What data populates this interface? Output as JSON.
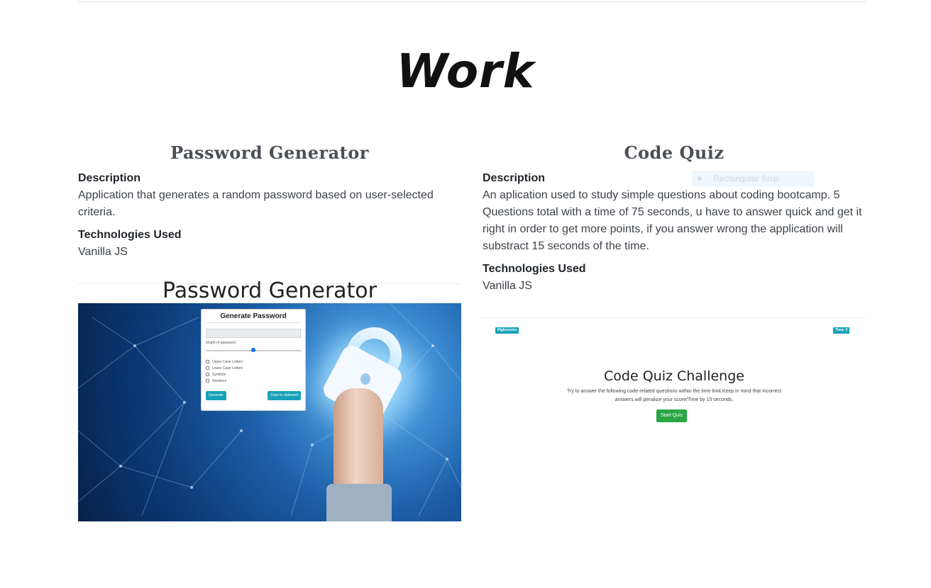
{
  "section": {
    "title": "Work"
  },
  "projects": [
    {
      "title": "Password Generator",
      "description_label": "Description",
      "description": "Application that generates a random password based on user-selected criteria.",
      "tech_label": "Technologies Used",
      "tech": "Vanilla JS",
      "screenshot": {
        "heading": "Password Generator",
        "card_title": "Generate Password",
        "length_label": "length of password",
        "length_value": 0.5,
        "checkboxes": [
          "Upper Case Letters",
          "Lower Case Letters",
          "Symbols",
          "Numbers"
        ],
        "generate_label": "Generate",
        "copy_label": "Copy to clipboard"
      }
    },
    {
      "title": "Code Quiz",
      "description_label": "Description",
      "description": "An aplication used to study simple questions about coding bootcamp. 5 Questions total with a time of 75 seconds, u have to answer quick and get it right in order to get more points, if you answer wrong the application will substract 15 seconds of the time.",
      "tech_label": "Technologies Used",
      "tech": "Vanilla JS",
      "screenshot": {
        "highscores_label": "Highscores",
        "time_label": "Time: 0",
        "title": "Code Quiz Challenge",
        "text": "Try to answer the following code-related questions within the time limit.Keep in mind that incorrect answers will penalize your score/Time by 15 seconds.",
        "start_label": "Start Quiz"
      }
    }
  ],
  "overlay": {
    "label": "Rectangular Snip"
  },
  "colors": {
    "accent": "#17a2b8",
    "success": "#28a745",
    "slider": "#0d6efd"
  },
  "icons": [
    "lock-icon",
    "hand-icon",
    "snip-icon"
  ]
}
